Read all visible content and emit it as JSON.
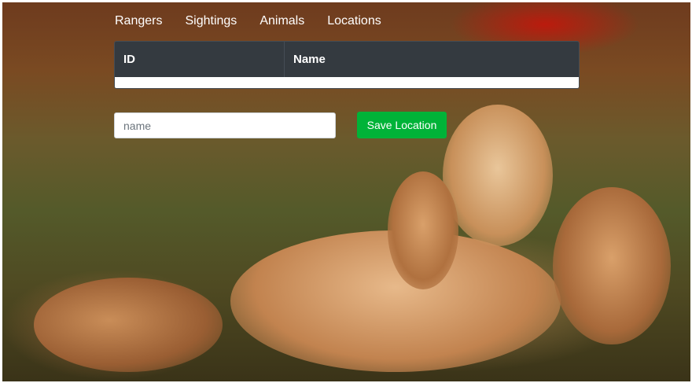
{
  "nav": {
    "items": [
      {
        "label": "Rangers"
      },
      {
        "label": "Sightings"
      },
      {
        "label": "Animals"
      },
      {
        "label": "Locations"
      }
    ]
  },
  "table": {
    "headers": {
      "id": "ID",
      "name": "Name"
    },
    "rows": []
  },
  "form": {
    "name_placeholder": "name",
    "name_value": "",
    "save_label": "Save Location"
  },
  "colors": {
    "header_bg": "#343a40",
    "button_bg": "#00b338",
    "nav_text": "#ffffff"
  },
  "background": {
    "description_icon": "lion-family-photo"
  }
}
